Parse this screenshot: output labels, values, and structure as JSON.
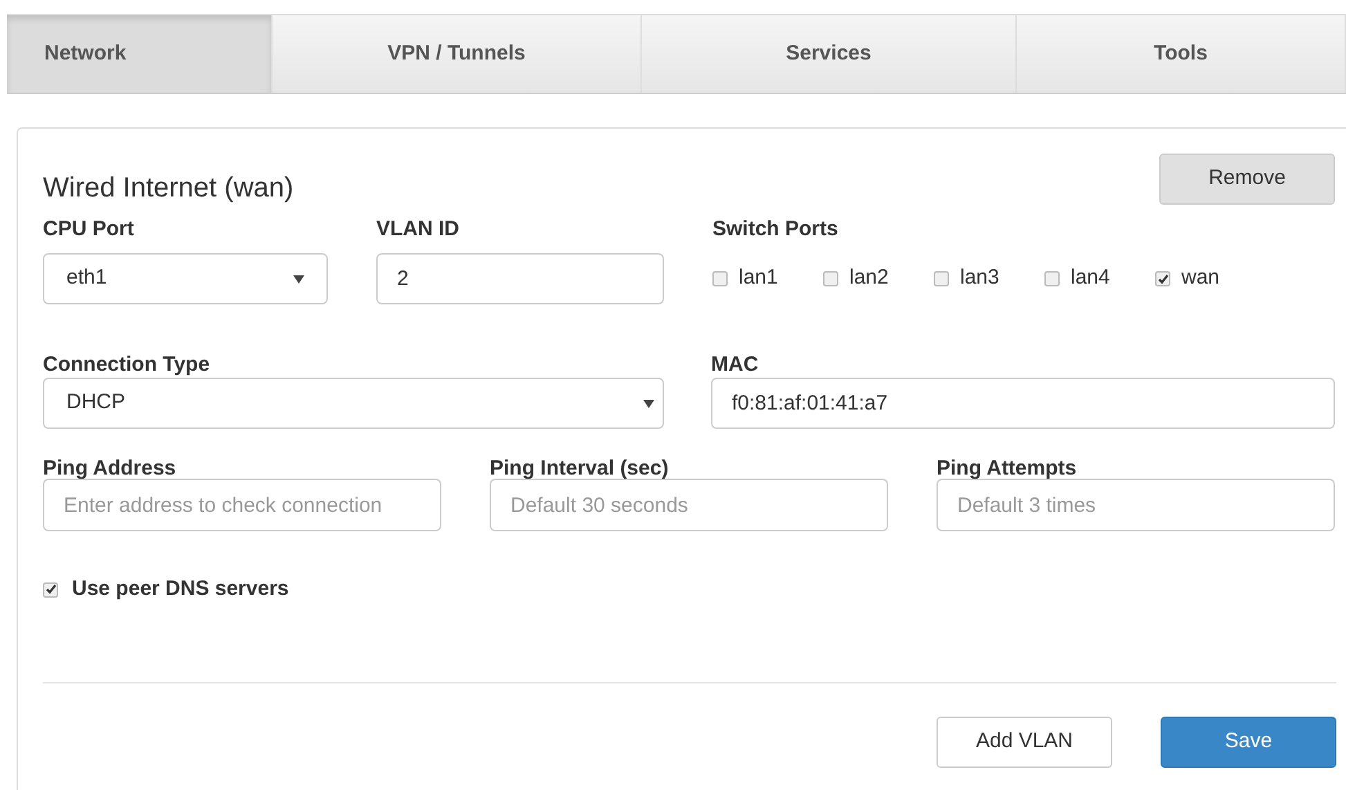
{
  "tabs": [
    {
      "label": "Network",
      "selected": true
    },
    {
      "label": "VPN / Tunnels",
      "selected": false
    },
    {
      "label": "Services",
      "selected": false
    },
    {
      "label": "Tools",
      "selected": false
    }
  ],
  "section": {
    "title": "Wired Internet (wan)",
    "remove_button": "Remove"
  },
  "cpu_port": {
    "label": "CPU Port",
    "value": "eth1"
  },
  "vlan_id": {
    "label": "VLAN ID",
    "value": "2"
  },
  "switch_ports": {
    "label": "Switch Ports",
    "ports": [
      {
        "label": "lan1",
        "checked": false
      },
      {
        "label": "lan2",
        "checked": false
      },
      {
        "label": "lan3",
        "checked": false
      },
      {
        "label": "lan4",
        "checked": false
      },
      {
        "label": "wan",
        "checked": true
      }
    ]
  },
  "connection_type": {
    "label": "Connection Type",
    "value": "DHCP"
  },
  "mac": {
    "label": "MAC",
    "value": "f0:81:af:01:41:a7"
  },
  "ping_fields": [
    {
      "label": "Ping Address",
      "placeholder": "Enter address to check connection"
    },
    {
      "label": "Ping Interval (sec)",
      "placeholder": "Default 30 seconds"
    },
    {
      "label": "Ping Attempts",
      "placeholder": "Default 3 times"
    }
  ],
  "use_peer_dns": {
    "label": "Use peer DNS servers",
    "checked": true
  },
  "buttons": [
    {
      "label": "Add VLAN",
      "kind": "default"
    },
    {
      "label": "Save",
      "kind": "primary"
    }
  ]
}
